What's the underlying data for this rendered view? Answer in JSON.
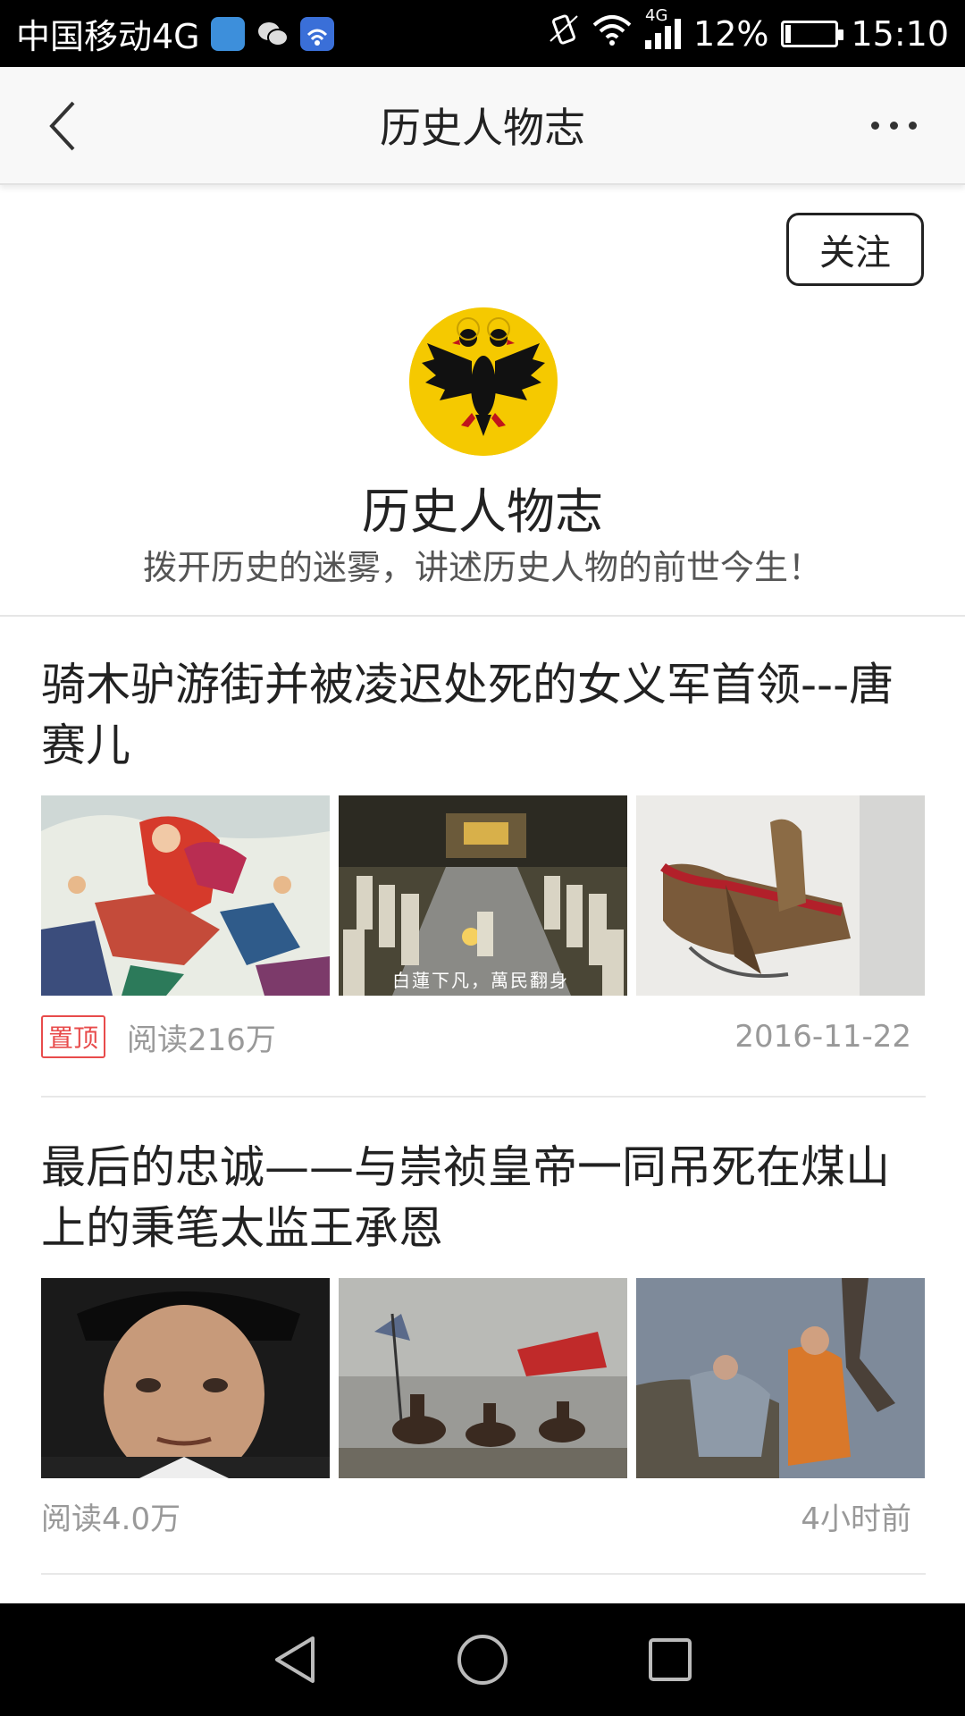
{
  "status_bar": {
    "carrier": "中国移动4G",
    "network": "4G",
    "battery": "12%",
    "battery_level": 0.12,
    "time": "15:10"
  },
  "nav": {
    "title": "历史人物志"
  },
  "profile": {
    "follow_label": "关注",
    "name": "历史人物志",
    "description": "拨开历史的迷雾，讲述历史人物的前世今生！"
  },
  "articles": [
    {
      "title": "骑木驴游街并被凌迟处死的女义军首领---唐赛儿",
      "pinned_label": "置顶",
      "reads": "阅读216万",
      "time": "2016-11-22",
      "thumb_caption_2": "白蓮下凡，萬民翻身"
    },
    {
      "title": "最后的忠诚——与崇祯皇帝一同吊死在煤山上的秉笔太监王承恩",
      "reads": "阅读4.0万",
      "time": "4小时前"
    }
  ],
  "colors": {
    "pin_red": "#e84b4b",
    "avatar_yellow": "#f5c900",
    "meta_gray": "#999999"
  }
}
